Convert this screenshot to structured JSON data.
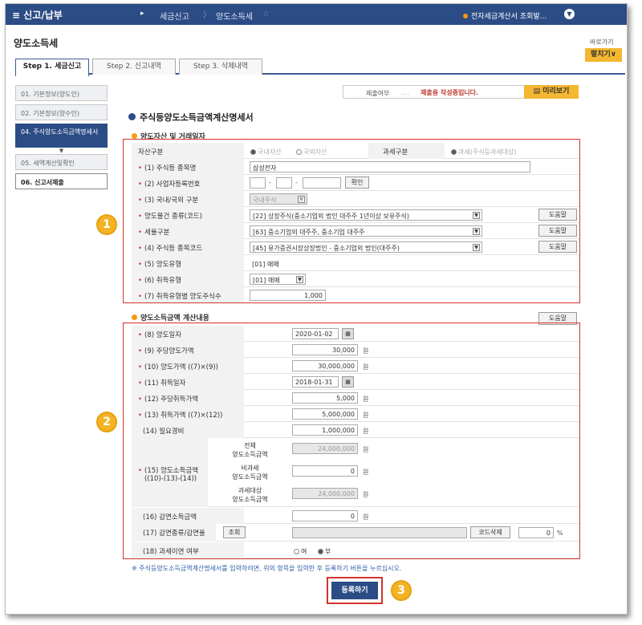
{
  "topbar": {
    "menu": "≡  신고/납부",
    "tab1": "세금신고",
    "tab2": "양도소득세",
    "notice": "전자세금계산서 조회발..."
  },
  "page_title": "양도소득세",
  "shortcut": {
    "label": "바로가기",
    "button": "펼치기∨"
  },
  "steps": [
    "Step 1. 세금신고",
    "Step 2. 신고내역",
    "Step 3. 삭제내역"
  ],
  "side": [
    "01. 기본정보(양도인)",
    "02. 기본정보(양수인)",
    "04. 주식양도소득금액명세서",
    "05. 세액계산및확인",
    "06. 신고서제출"
  ],
  "submit": {
    "label": "제출여부",
    "dots": "....",
    "msg": "제출용 작성중입니다.",
    "preview": "미리보기"
  },
  "section_title": "주식등양도소득금액계산명세서",
  "sub1": "양도자산 및 거래일자",
  "sub2": "양도소득금액 계산내용",
  "help": "도움말",
  "f": {
    "asset_type": "자산구분",
    "domestic": "국내자산",
    "foreign": "국외자산",
    "tax_type": "과세구분",
    "tax_opt": "과세(주식등과세대상)",
    "stock_name_l": "(1) 주식등 종목명",
    "stock_name": "삼성전자",
    "bizno_l": "(2) 사업자등록번호",
    "confirm": "확인",
    "dom_l": "(3) 국내/국외 구분",
    "dom": "국내주식",
    "kind_l": "양도물건 종류(코드)",
    "kind": "[22] 상장주식(중소기업외 법인 대주주 1년이상 보유주식)",
    "rate_l": "세율구분",
    "rate": "[63] 중소기업외 대주주, 중소기업 대주주",
    "code_l": "(4) 주식등 종목코드",
    "code": "[45] 유가증권시장상장법인 - 중소기업외 법인(대주주)",
    "ttype_l": "(5) 양도유형",
    "ttype": "[01] 매매",
    "atype_l": "(6) 취득유형",
    "atype": "[01] 매매",
    "qty_l": "(7) 취득유형별 양도주식수",
    "qty": "1,000",
    "tdate_l": "(8) 양도일자",
    "tdate": "2020-01-02",
    "tprice_l": "(9) 주당양도가액",
    "tprice": "30,000",
    "tamt_l": "(10) 양도가액 ((7)×(9))",
    "tamt": "30,000,000",
    "adate_l": "(11) 취득일자",
    "adate": "2018-01-31",
    "aprice_l": "(12) 주당취득가액",
    "aprice": "5,000",
    "aamt_l": "(13) 취득가액 ((7)×(12))",
    "aamt": "5,000,000",
    "exp_l": "(14) 필요경비",
    "exp": "1,000,000",
    "gain_l1": "(15) 양도소득금액",
    "gain_l2": "((10)-(13)-(14))",
    "total_l1": "전체",
    "total_l2": "양도소득금액",
    "total": "24,000,000",
    "nontax_l1": "비과세",
    "nontax_l2": "양도소득금액",
    "nontax": "0",
    "taxable_l1": "과세대상",
    "taxable_l2": "양도소득금액",
    "taxable": "24,000,000",
    "reduce_l": "(16) 감면소득금액",
    "reduce": "0",
    "rtype_l": "(17) 감면종류/감면율",
    "lookup": "조회",
    "codedel": "코드삭제",
    "rpct": "0",
    "defer_l": "(18) 과세이연 여부",
    "yes": "여",
    "no": "부",
    "won": "원",
    "pct": "%"
  },
  "note": "※ 주식등양도소득금액계산명세서를 입력하려면, 위의 항목을 입력한 후 등록하기 버튼을 누르십시오.",
  "register": "등록하기",
  "markers": [
    "1",
    "2",
    "3"
  ]
}
